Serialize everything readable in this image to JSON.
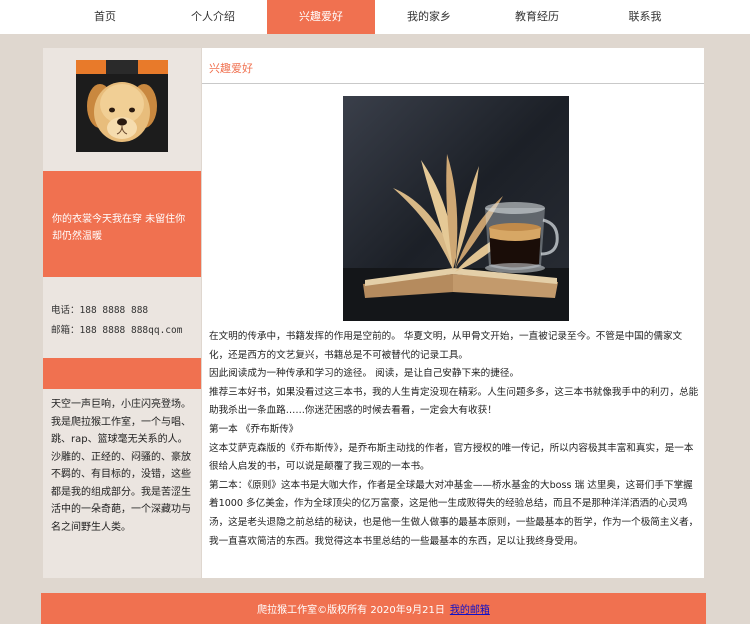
{
  "nav": {
    "items": [
      {
        "label": "首页"
      },
      {
        "label": "个人介绍"
      },
      {
        "label": "兴趣爱好",
        "active": true
      },
      {
        "label": "我的家乡"
      },
      {
        "label": "教育经历"
      },
      {
        "label": "联系我"
      }
    ]
  },
  "sidebar": {
    "quote": "你的衣裳今天我在穿 未留住你却仍然温暖",
    "phone": "电话：188 8888 888",
    "email": "邮箱：188 8888 888qq.com",
    "intro": "天空一声巨响，小庄闪亮登场。我是爬拉猴工作室，一个与唱、跳、rap、篮球毫无关系的人。沙雕的、正经的、闷骚的、豪放不羁的、有目标的，没错，这些都是我的组成部分。我是苦涩生活中的一朵奇葩，一个深藏功与名之间野生人类。"
  },
  "main": {
    "title": "兴趣爱好",
    "paragraphs": [
      "在文明的传承中，书籍发挥的作用是空前的。 华夏文明，从甲骨文开始，一直被记录至今。不管是中国的儒家文化，还是西方的文艺复兴，书籍总是不可被替代的记录工具。",
      "因此阅读成为一种传承和学习的途径。 阅读，是让自己安静下来的捷径。",
      "推荐三本好书，如果没看过这三本书，我的人生肯定没现在精彩。人生问题多多，这三本书就像我手中的利刃，总能助我杀出一条血路……你迷茫困惑的时候去看看，一定会大有收获！",
      "第一本 《乔布斯传》",
      "这本艾萨克森版的《乔布斯传》，是乔布斯主动找的作者，官方授权的唯一传记，所以内容极其丰富和真实，是一本很给人启发的书，可以说是颠覆了我三观的一本书。",
      "第二本：《原则》这本书是大咖大作，作者是全球最大对冲基金——桥水基金的大boss 瑞 达里奥，这哥们手下掌握着1000 多亿美金，作为全球顶尖的亿万富豪，这是他一生成败得失的经验总结，而且不是那种洋洋洒洒的心灵鸡汤，这是老头退隐之前总结的秘诀，也是他一生做人做事的最基本原则，一些最基本的哲学，作为一个极简主义者，我一直喜欢简洁的东西。我觉得这本书里总结的一些最基本的东西，足以让我终身受用。"
    ]
  },
  "footer": {
    "text": "爬拉猴工作室©版权所有  2020年9月21日",
    "link": "我的邮箱"
  },
  "colors": {
    "accent": "#f07150",
    "background": "#dfd7cf",
    "sidebar": "#ebe5e0",
    "link": "#1010c8"
  }
}
